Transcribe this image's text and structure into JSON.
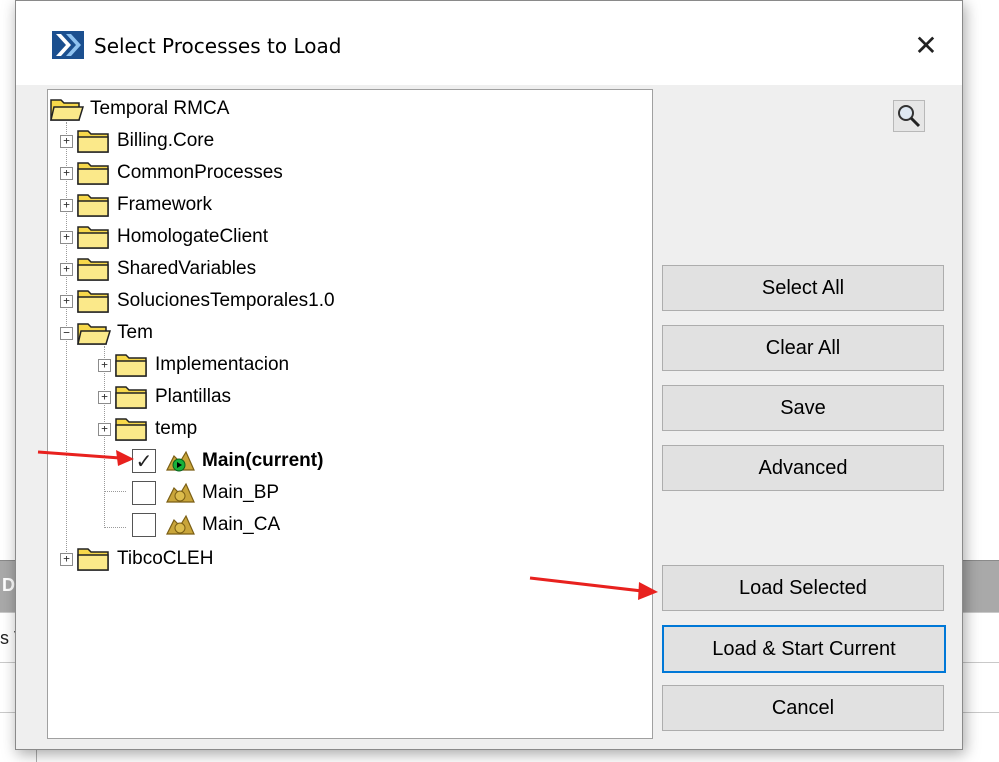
{
  "dialog": {
    "title": "Select Processes to Load",
    "close_glyph": "✕"
  },
  "tree": {
    "root": "Temporal RMCA",
    "top_folders": [
      "Billing.Core",
      "CommonProcesses",
      "Framework",
      "HomologateClient",
      "SharedVariables",
      "SolucionesTemporales1.0"
    ],
    "tem": {
      "label": "Tem",
      "subfolders": [
        "Implementacion",
        "Plantillas",
        "temp"
      ],
      "processes": [
        {
          "label": "Main(current)",
          "checked": true
        },
        {
          "label": "Main_BP",
          "checked": false
        },
        {
          "label": "Main_CA",
          "checked": false
        }
      ]
    },
    "last_folder": "TibcoCLEH"
  },
  "buttons": {
    "select_all": "Select All",
    "clear_all": "Clear All",
    "save": "Save",
    "advanced": "Advanced",
    "load_selected": "Load Selected",
    "load_start_current": "Load & Start Current",
    "cancel": "Cancel"
  },
  "background_app": {
    "header_fragment": "De",
    "text_fragment": "s V"
  },
  "colors": {
    "accent": "#0078d7",
    "annotation_arrow": "#e8211e",
    "folder": "#f7d84a"
  },
  "icons": [
    "app-logo-icon",
    "close-icon",
    "search-icon",
    "folder-icon",
    "process-icon",
    "checkbox-icon",
    "expand-icon",
    "collapse-icon"
  ]
}
